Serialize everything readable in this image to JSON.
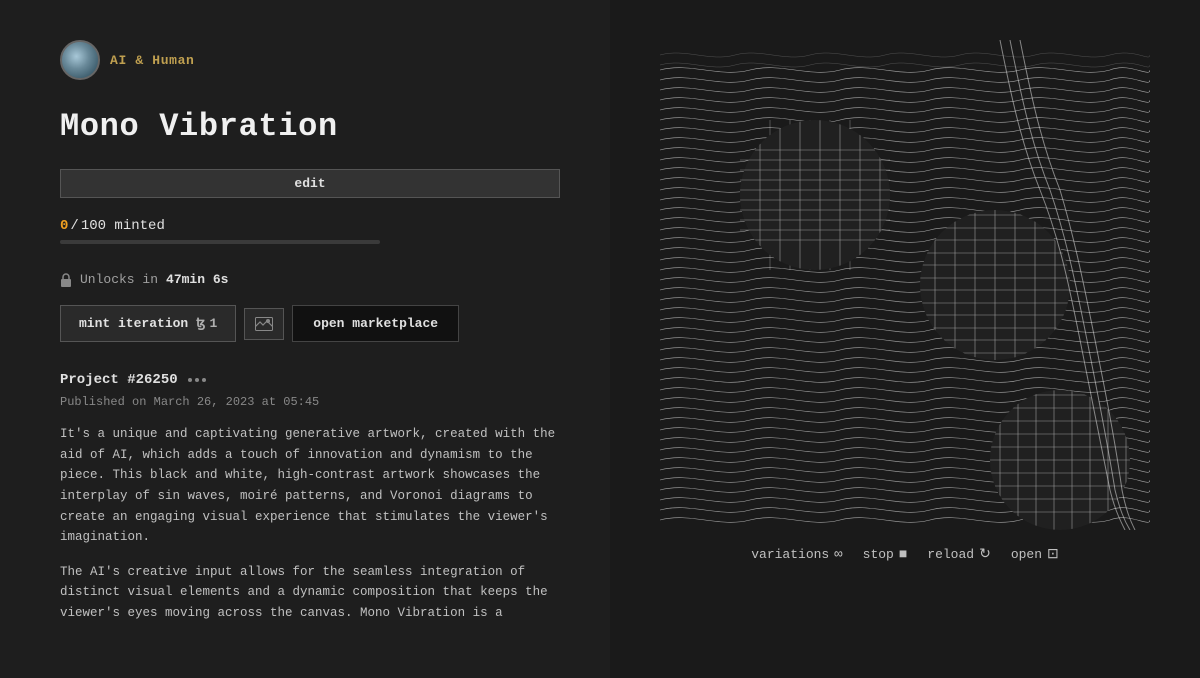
{
  "author": {
    "name": "AI & Human",
    "avatar_description": "globe-like avatar"
  },
  "project": {
    "title": "Mono Vibration",
    "edit_label": "edit",
    "minted_current": "0",
    "minted_separator": "/",
    "minted_total": "100",
    "minted_suffix": " minted",
    "progress_percent": 0,
    "unlock_prefix": "Unlocks in",
    "unlock_time": "47min 6s",
    "number_label": "Project #26250",
    "publish_date": "Published on March 26, 2023 at 05:45",
    "description_1": "It's a unique and captivating generative artwork, created with the aid of AI, which adds a touch of innovation and dynamism to the piece. This black and white, high-contrast artwork showcases the interplay of sin waves, moiré patterns, and Voronoi diagrams to create an engaging visual experience that stimulates the viewer's imagination.",
    "description_2": "The AI's creative input allows for the seamless integration of distinct visual elements and a dynamic composition that keeps the viewer's eyes moving across the canvas. Mono Vibration is a"
  },
  "actions": {
    "mint_label": "mint iteration",
    "mint_price": "1",
    "mint_currency": "ꜩ",
    "marketplace_label": "open marketplace"
  },
  "controls": {
    "variations_label": "variations",
    "variations_icon": "∞",
    "stop_label": "stop",
    "stop_icon": "■",
    "reload_label": "reload",
    "reload_icon": "↻",
    "open_label": "open",
    "open_icon": "⊡"
  }
}
